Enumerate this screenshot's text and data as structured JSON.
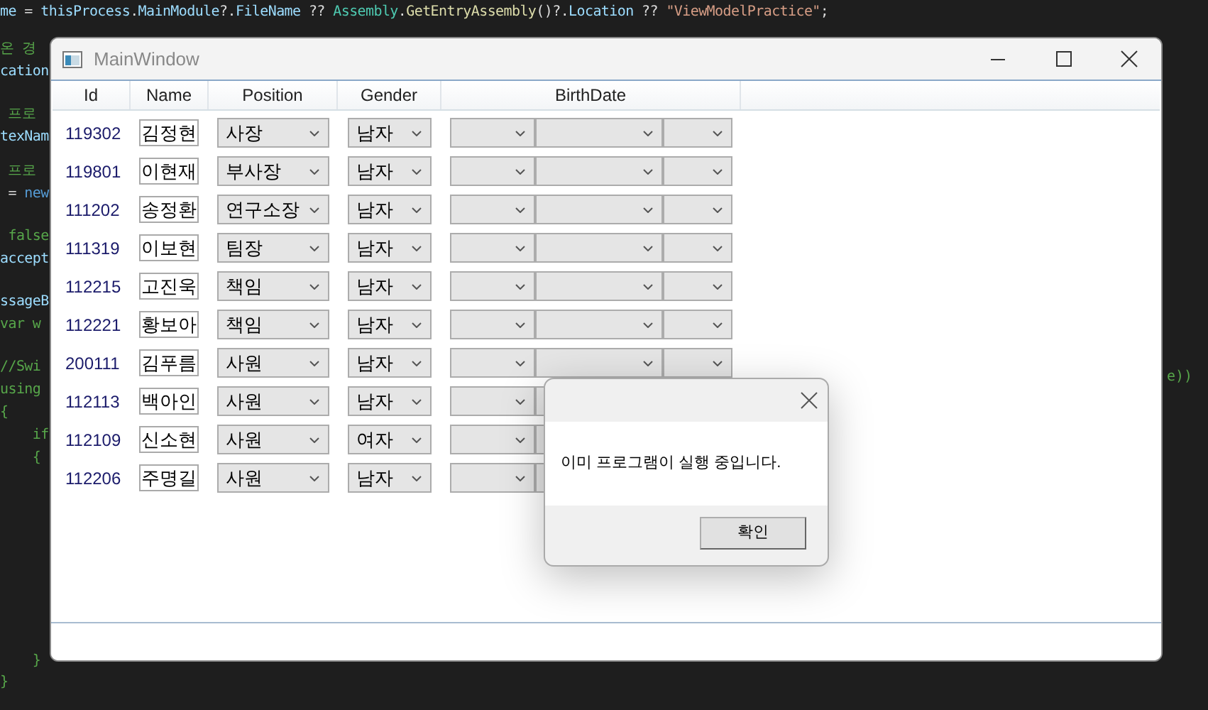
{
  "editor": {
    "lines": [
      {
        "tokens": [
          {
            "kind": "ident",
            "text": "me"
          },
          {
            "kind": "plain",
            "text": " = "
          },
          {
            "kind": "ident",
            "text": "thisProcess"
          },
          {
            "kind": "plain",
            "text": "."
          },
          {
            "kind": "ident",
            "text": "MainModule"
          },
          {
            "kind": "plain",
            "text": "?."
          },
          {
            "kind": "ident",
            "text": "FileName"
          },
          {
            "kind": "plain",
            "text": " ?? "
          },
          {
            "kind": "type",
            "text": "Assembly"
          },
          {
            "kind": "plain",
            "text": "."
          },
          {
            "kind": "method",
            "text": "GetEntryAssembly"
          },
          {
            "kind": "plain",
            "text": "()?."
          },
          {
            "kind": "ident",
            "text": "Location"
          },
          {
            "kind": "plain",
            "text": " ?? "
          },
          {
            "kind": "string",
            "text": "\"ViewModelPractice\""
          },
          {
            "kind": "plain",
            "text": ";"
          }
        ]
      },
      {
        "tokens": [
          {
            "kind": "comment",
            "text": "온 경"
          }
        ]
      },
      {
        "tokens": [
          {
            "kind": "ident",
            "text": "cation"
          }
        ]
      },
      {
        "tokens": [
          {
            "kind": "comment",
            "text": " 프로"
          }
        ]
      },
      {
        "tokens": [
          {
            "kind": "ident",
            "text": "texNam"
          }
        ]
      },
      {
        "tokens": [
          {
            "kind": "comment",
            "text": " 프로"
          }
        ]
      },
      {
        "tokens": [
          {
            "kind": "plain",
            "text": " = "
          },
          {
            "kind": "keyword",
            "text": "new"
          }
        ]
      },
      {
        "tokens": [
          {
            "kind": "comment",
            "text": " false"
          }
        ]
      },
      {
        "tokens": [
          {
            "kind": "ident",
            "text": "accept"
          }
        ]
      },
      {
        "tokens": [
          {
            "kind": "ident",
            "text": "ssageB"
          }
        ]
      },
      {
        "tokens": [
          {
            "kind": "comment",
            "text": "var w"
          }
        ]
      },
      {
        "tokens": [
          {
            "kind": "comment",
            "text": "//Swi"
          }
        ]
      },
      {
        "tokens": [
          {
            "kind": "comment",
            "text": "using"
          }
        ]
      },
      {
        "tokens": [
          {
            "kind": "comment",
            "text": "{"
          }
        ]
      },
      {
        "tokens": [
          {
            "kind": "comment",
            "text": "    if"
          }
        ]
      },
      {
        "tokens": [
          {
            "kind": "comment",
            "text": "    {"
          }
        ]
      }
    ],
    "bottom_lines": [
      {
        "tokens": [
          {
            "kind": "comment",
            "text": "    }"
          }
        ]
      },
      {
        "tokens": [
          {
            "kind": "comment",
            "text": "}"
          }
        ]
      }
    ],
    "right_fragment": "e))"
  },
  "window": {
    "title": "MainWindow",
    "columns": [
      "Id",
      "Name",
      "Position",
      "Gender",
      "BirthDate"
    ],
    "rows": [
      {
        "id": "119302",
        "name": "김정현",
        "position": "사장",
        "gender": "남자"
      },
      {
        "id": "119801",
        "name": "이현재",
        "position": "부사장",
        "gender": "남자"
      },
      {
        "id": "111202",
        "name": "송정환",
        "position": "연구소장",
        "gender": "남자"
      },
      {
        "id": "111319",
        "name": "이보현",
        "position": "팀장",
        "gender": "남자"
      },
      {
        "id": "112215",
        "name": "고진욱",
        "position": "책임",
        "gender": "남자"
      },
      {
        "id": "112221",
        "name": "황보아",
        "position": "책임",
        "gender": "남자"
      },
      {
        "id": "200111",
        "name": "김푸름",
        "position": "사원",
        "gender": "남자"
      },
      {
        "id": "112113",
        "name": "백아인",
        "position": "사원",
        "gender": "남자",
        "under_dialog": true
      },
      {
        "id": "112109",
        "name": "신소현",
        "position": "사원",
        "gender": "여자",
        "under_dialog": true
      },
      {
        "id": "112206",
        "name": "주명길",
        "position": "사원",
        "gender": "남자",
        "under_dialog": true
      }
    ]
  },
  "dialog": {
    "message": "이미 프로그램이 실행 중입니다.",
    "button": "확인"
  }
}
